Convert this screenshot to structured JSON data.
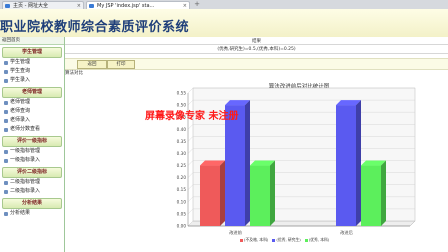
{
  "browser": {
    "tabs": [
      {
        "label": "主页 - 网址大全",
        "active": false
      },
      {
        "label": "My JSP 'index.jsp' sta...",
        "active": true
      }
    ],
    "new_tab": "+"
  },
  "header": {
    "title": "职业院校教师综合素质评价系统"
  },
  "sidebar": {
    "top_label": "返回首页",
    "groups": [
      {
        "title": "学生管理",
        "items": [
          "学生管理",
          "学生查询",
          "学生录入"
        ]
      },
      {
        "title": "老师管理",
        "items": [
          "老师管理",
          "老师查询",
          "老师录入",
          "老师分数查看"
        ]
      },
      {
        "title": "评价一级指标",
        "items": [
          "一级指标管理",
          "一级指标录入"
        ]
      },
      {
        "title": "评价二级指标",
        "items": [
          "二级指标管理",
          "二级指标录入"
        ]
      },
      {
        "title": "分析结果",
        "items": [
          "分析结果"
        ]
      }
    ]
  },
  "main": {
    "caption_top": "结果",
    "caption_formula": "(优秀,研究生)=0.5,(优秀,本科)=0.25)",
    "buttons": {
      "back": "返回",
      "print": "打印"
    },
    "sub_label": "算法对比",
    "watermark": "屏幕录像专家 未注册"
  },
  "chart_data": {
    "type": "bar",
    "title": "算法改进前后对比统计图",
    "categories": [
      "改进前",
      "改进后"
    ],
    "series": [
      {
        "name": "(不及格, 本科)",
        "color": "#ef5a5a",
        "values": [
          0.25,
          0.0
        ]
      },
      {
        "name": "(优秀, 研究生)",
        "color": "#5a5af0",
        "values": [
          0.5,
          0.5
        ]
      },
      {
        "name": "(优秀, 本科)",
        "color": "#5cef5c",
        "values": [
          0.25,
          0.25
        ]
      }
    ],
    "ylim": [
      0,
      0.55
    ],
    "yticks": [
      "0.00",
      "0.05",
      "0.10",
      "0.15",
      "0.20",
      "0.25",
      "0.30",
      "0.35",
      "0.40",
      "0.45",
      "0.50",
      "0.55"
    ],
    "grid": true,
    "legend": "bottom"
  }
}
